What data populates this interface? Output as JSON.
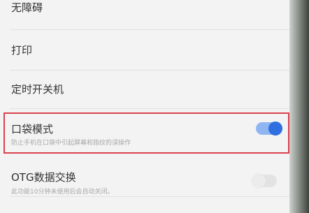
{
  "settings": {
    "items": [
      {
        "title": "无障碍"
      },
      {
        "title": "打印"
      },
      {
        "title": "定时开关机"
      },
      {
        "title": "口袋模式",
        "subtitle": "防止手机在口袋中引起屏幕和指纹的误操作",
        "toggle": "on",
        "highlighted": true
      },
      {
        "title": "OTG数据交换",
        "subtitle": "此功能10分钟未使用后会自动关闭。",
        "toggle": "off"
      }
    ]
  },
  "colors": {
    "accent": "#2f6fe0",
    "highlight_border": "#d8424e",
    "background": "#f3f3f3"
  }
}
